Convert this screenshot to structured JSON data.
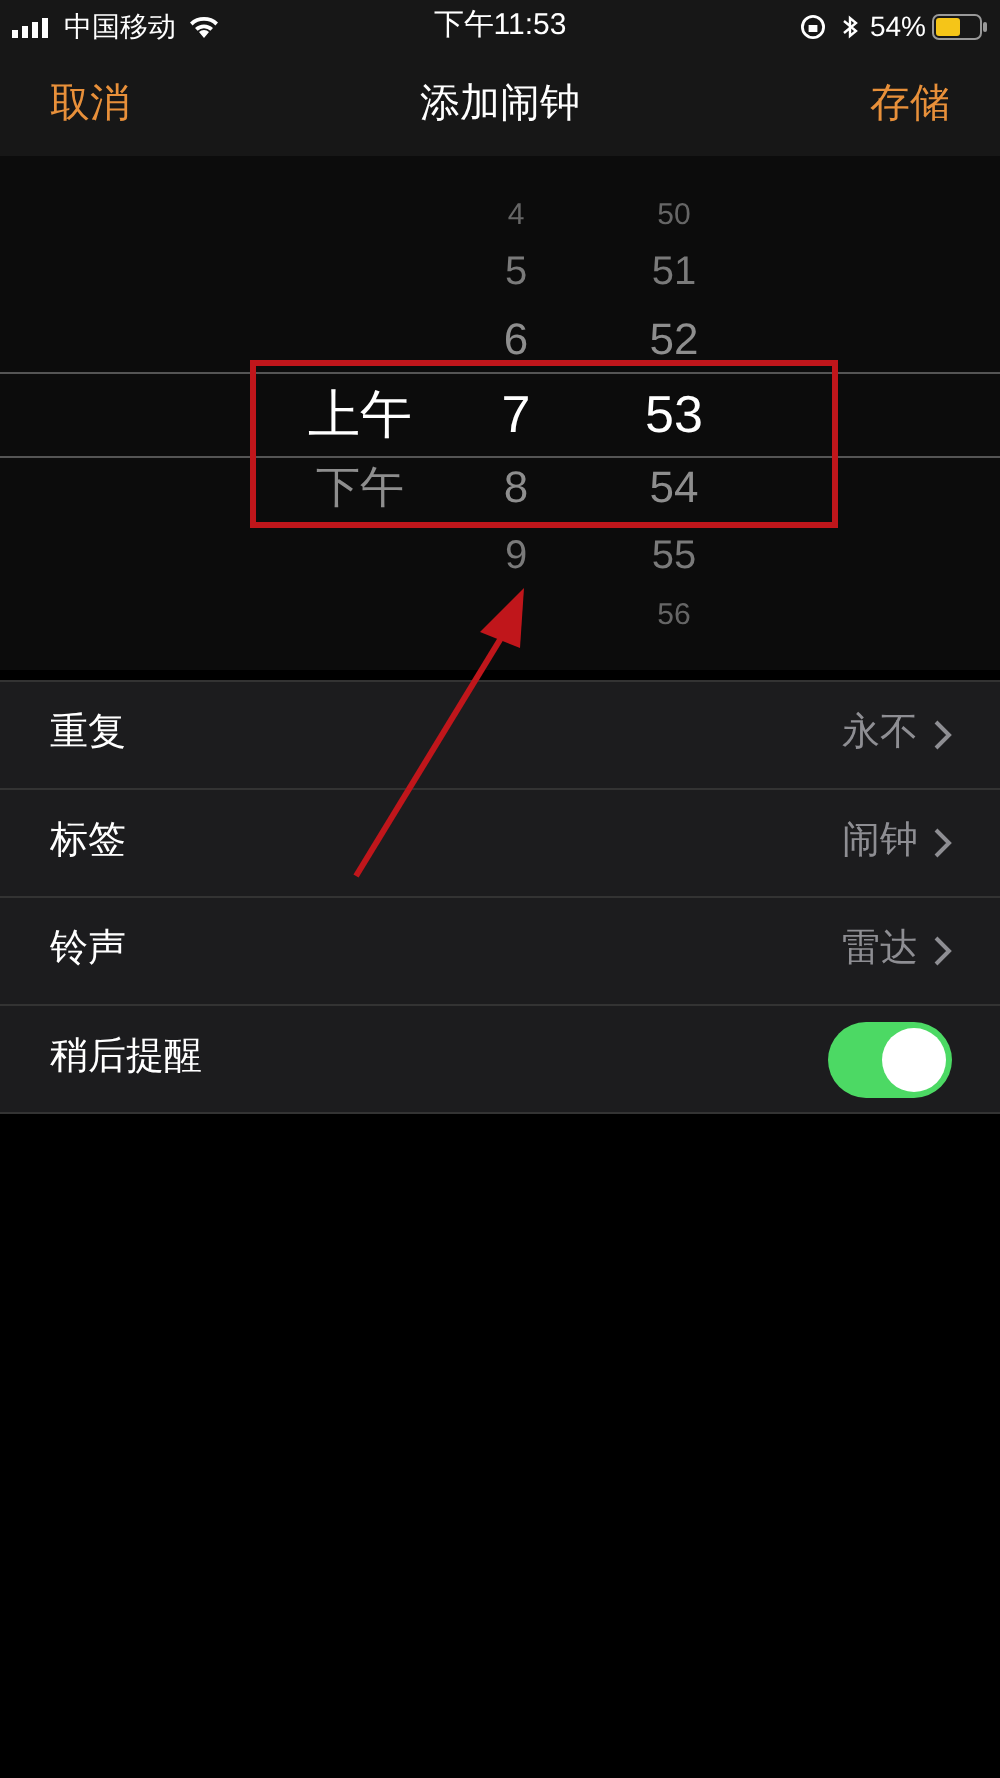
{
  "status_bar": {
    "carrier": "中国移动",
    "time": "下午11:53",
    "battery_text": "54%"
  },
  "nav": {
    "cancel": "取消",
    "title": "添加闹钟",
    "save": "存储"
  },
  "picker": {
    "columns": [
      {
        "kind": "period",
        "items": [
          {
            "text": "上午",
            "selected": true
          },
          {
            "text": "下午",
            "selected": false
          }
        ]
      },
      {
        "kind": "hour",
        "items": [
          {
            "text": "4",
            "selected": false
          },
          {
            "text": "5",
            "selected": false
          },
          {
            "text": "6",
            "selected": false
          },
          {
            "text": "7",
            "selected": true
          },
          {
            "text": "8",
            "selected": false
          },
          {
            "text": "9",
            "selected": false
          }
        ]
      },
      {
        "kind": "minute",
        "items": [
          {
            "text": "50",
            "selected": false
          },
          {
            "text": "51",
            "selected": false
          },
          {
            "text": "52",
            "selected": false
          },
          {
            "text": "53",
            "selected": true
          },
          {
            "text": "54",
            "selected": false
          },
          {
            "text": "55",
            "selected": false
          },
          {
            "text": "56",
            "selected": false
          }
        ]
      }
    ]
  },
  "settings": [
    {
      "kind": "link",
      "label": "重复",
      "value": "永不"
    },
    {
      "kind": "link",
      "label": "标签",
      "value": "闹钟"
    },
    {
      "kind": "link",
      "label": "铃声",
      "value": "雷达"
    },
    {
      "kind": "toggle",
      "label": "稍后提醒",
      "on": true
    }
  ]
}
